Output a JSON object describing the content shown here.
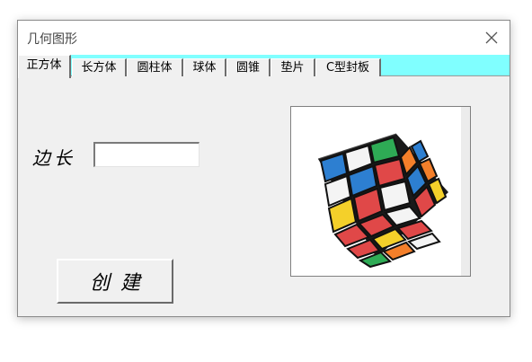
{
  "window": {
    "title": "几何图形"
  },
  "tabs": [
    {
      "label": "正方体",
      "active": true
    },
    {
      "label": "长方体",
      "active": false
    },
    {
      "label": "圆柱体",
      "active": false
    },
    {
      "label": "球体",
      "active": false
    },
    {
      "label": "圆锥",
      "active": false
    },
    {
      "label": "垫片",
      "active": false
    },
    {
      "label": "C型封板",
      "active": false
    }
  ],
  "form": {
    "side_label": "边长",
    "side_value": "",
    "create_label": "创建"
  },
  "image": {
    "icon": "rubiks-cube-image"
  },
  "colors": {
    "tabstrip_bg": "#80ffff",
    "window_bg": "#f0f0f0"
  }
}
